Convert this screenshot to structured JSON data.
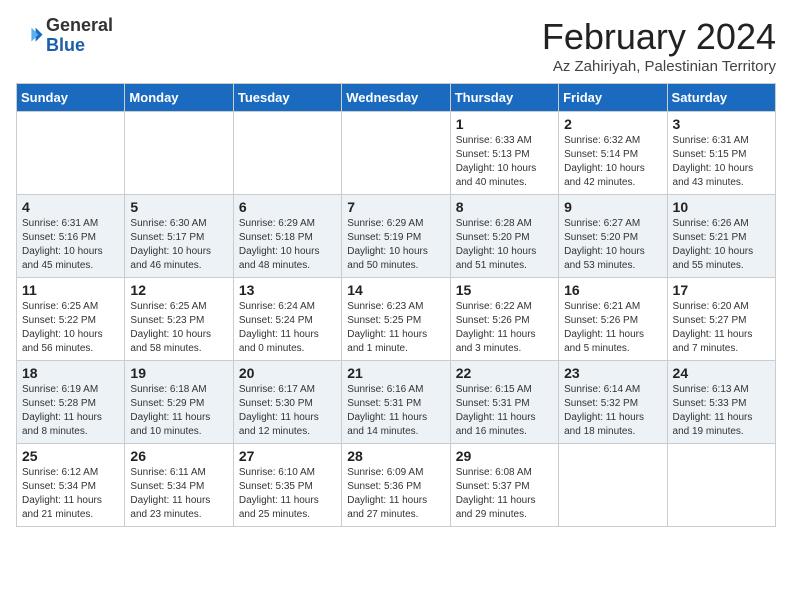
{
  "header": {
    "logo_general": "General",
    "logo_blue": "Blue",
    "month_title": "February 2024",
    "location": "Az Zahiriyah, Palestinian Territory"
  },
  "days_of_week": [
    "Sunday",
    "Monday",
    "Tuesday",
    "Wednesday",
    "Thursday",
    "Friday",
    "Saturday"
  ],
  "weeks": [
    [
      {
        "day": "",
        "info": ""
      },
      {
        "day": "",
        "info": ""
      },
      {
        "day": "",
        "info": ""
      },
      {
        "day": "",
        "info": ""
      },
      {
        "day": "1",
        "info": "Sunrise: 6:33 AM\nSunset: 5:13 PM\nDaylight: 10 hours\nand 40 minutes."
      },
      {
        "day": "2",
        "info": "Sunrise: 6:32 AM\nSunset: 5:14 PM\nDaylight: 10 hours\nand 42 minutes."
      },
      {
        "day": "3",
        "info": "Sunrise: 6:31 AM\nSunset: 5:15 PM\nDaylight: 10 hours\nand 43 minutes."
      }
    ],
    [
      {
        "day": "4",
        "info": "Sunrise: 6:31 AM\nSunset: 5:16 PM\nDaylight: 10 hours\nand 45 minutes."
      },
      {
        "day": "5",
        "info": "Sunrise: 6:30 AM\nSunset: 5:17 PM\nDaylight: 10 hours\nand 46 minutes."
      },
      {
        "day": "6",
        "info": "Sunrise: 6:29 AM\nSunset: 5:18 PM\nDaylight: 10 hours\nand 48 minutes."
      },
      {
        "day": "7",
        "info": "Sunrise: 6:29 AM\nSunset: 5:19 PM\nDaylight: 10 hours\nand 50 minutes."
      },
      {
        "day": "8",
        "info": "Sunrise: 6:28 AM\nSunset: 5:20 PM\nDaylight: 10 hours\nand 51 minutes."
      },
      {
        "day": "9",
        "info": "Sunrise: 6:27 AM\nSunset: 5:20 PM\nDaylight: 10 hours\nand 53 minutes."
      },
      {
        "day": "10",
        "info": "Sunrise: 6:26 AM\nSunset: 5:21 PM\nDaylight: 10 hours\nand 55 minutes."
      }
    ],
    [
      {
        "day": "11",
        "info": "Sunrise: 6:25 AM\nSunset: 5:22 PM\nDaylight: 10 hours\nand 56 minutes."
      },
      {
        "day": "12",
        "info": "Sunrise: 6:25 AM\nSunset: 5:23 PM\nDaylight: 10 hours\nand 58 minutes."
      },
      {
        "day": "13",
        "info": "Sunrise: 6:24 AM\nSunset: 5:24 PM\nDaylight: 11 hours\nand 0 minutes."
      },
      {
        "day": "14",
        "info": "Sunrise: 6:23 AM\nSunset: 5:25 PM\nDaylight: 11 hours\nand 1 minute."
      },
      {
        "day": "15",
        "info": "Sunrise: 6:22 AM\nSunset: 5:26 PM\nDaylight: 11 hours\nand 3 minutes."
      },
      {
        "day": "16",
        "info": "Sunrise: 6:21 AM\nSunset: 5:26 PM\nDaylight: 11 hours\nand 5 minutes."
      },
      {
        "day": "17",
        "info": "Sunrise: 6:20 AM\nSunset: 5:27 PM\nDaylight: 11 hours\nand 7 minutes."
      }
    ],
    [
      {
        "day": "18",
        "info": "Sunrise: 6:19 AM\nSunset: 5:28 PM\nDaylight: 11 hours\nand 8 minutes."
      },
      {
        "day": "19",
        "info": "Sunrise: 6:18 AM\nSunset: 5:29 PM\nDaylight: 11 hours\nand 10 minutes."
      },
      {
        "day": "20",
        "info": "Sunrise: 6:17 AM\nSunset: 5:30 PM\nDaylight: 11 hours\nand 12 minutes."
      },
      {
        "day": "21",
        "info": "Sunrise: 6:16 AM\nSunset: 5:31 PM\nDaylight: 11 hours\nand 14 minutes."
      },
      {
        "day": "22",
        "info": "Sunrise: 6:15 AM\nSunset: 5:31 PM\nDaylight: 11 hours\nand 16 minutes."
      },
      {
        "day": "23",
        "info": "Sunrise: 6:14 AM\nSunset: 5:32 PM\nDaylight: 11 hours\nand 18 minutes."
      },
      {
        "day": "24",
        "info": "Sunrise: 6:13 AM\nSunset: 5:33 PM\nDaylight: 11 hours\nand 19 minutes."
      }
    ],
    [
      {
        "day": "25",
        "info": "Sunrise: 6:12 AM\nSunset: 5:34 PM\nDaylight: 11 hours\nand 21 minutes."
      },
      {
        "day": "26",
        "info": "Sunrise: 6:11 AM\nSunset: 5:34 PM\nDaylight: 11 hours\nand 23 minutes."
      },
      {
        "day": "27",
        "info": "Sunrise: 6:10 AM\nSunset: 5:35 PM\nDaylight: 11 hours\nand 25 minutes."
      },
      {
        "day": "28",
        "info": "Sunrise: 6:09 AM\nSunset: 5:36 PM\nDaylight: 11 hours\nand 27 minutes."
      },
      {
        "day": "29",
        "info": "Sunrise: 6:08 AM\nSunset: 5:37 PM\nDaylight: 11 hours\nand 29 minutes."
      },
      {
        "day": "",
        "info": ""
      },
      {
        "day": "",
        "info": ""
      }
    ]
  ]
}
